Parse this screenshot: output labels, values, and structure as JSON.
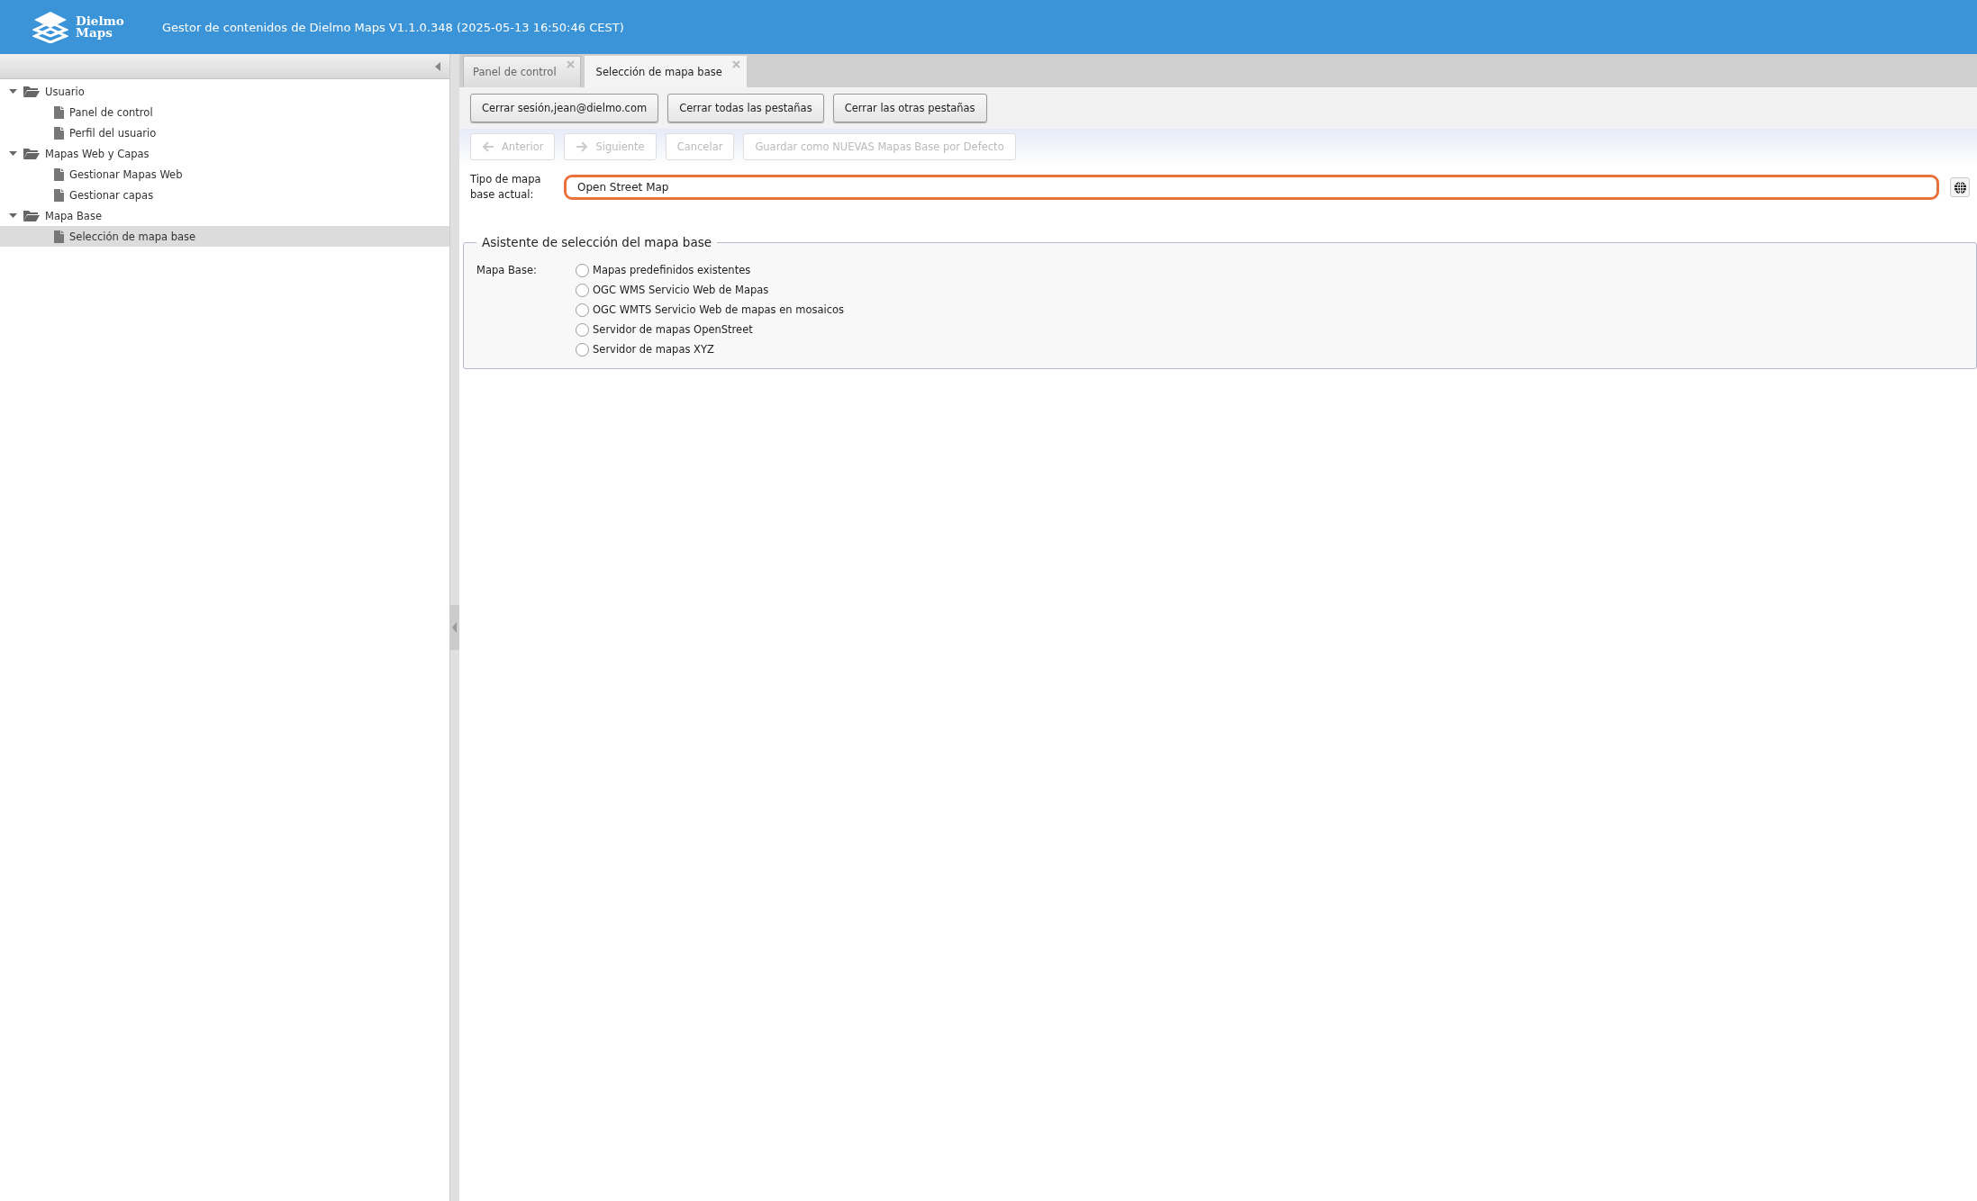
{
  "header": {
    "logo_lines": [
      "Dielmo",
      "Maps"
    ],
    "title": "Gestor de contenidos de Dielmo Maps V1.1.0.348 (2025-05-13 16:50:46 CEST)"
  },
  "sidebar": {
    "tree": [
      {
        "label": "Usuario",
        "kind": "folder",
        "expanded": true,
        "selected": false,
        "children": [
          {
            "label": "Panel de control",
            "kind": "page",
            "selected": false
          },
          {
            "label": "Perfil del usuario",
            "kind": "page",
            "selected": false
          }
        ]
      },
      {
        "label": "Mapas Web y Capas",
        "kind": "folder",
        "expanded": true,
        "selected": false,
        "children": [
          {
            "label": "Gestionar Mapas Web",
            "kind": "page",
            "selected": false
          },
          {
            "label": "Gestionar capas",
            "kind": "page",
            "selected": false
          }
        ]
      },
      {
        "label": "Mapa Base",
        "kind": "folder",
        "expanded": true,
        "selected": false,
        "children": [
          {
            "label": "Selección de mapa base",
            "kind": "page",
            "selected": true
          }
        ]
      }
    ]
  },
  "tabs": [
    {
      "label": "Panel de control",
      "selected": false
    },
    {
      "label": "Selección de mapa base",
      "selected": true
    }
  ],
  "toolbar": [
    "Cerrar sesión,jean@dielmo.com",
    "Cerrar todas las pestañas",
    "Cerrar las otras pestañas"
  ],
  "wizard_nav": [
    {
      "label": "Anterior",
      "kind": "back",
      "disabled": true
    },
    {
      "label": "Siguiente",
      "kind": "next",
      "disabled": true
    },
    {
      "label": "Cancelar",
      "kind": "plain",
      "disabled": true
    },
    {
      "label": "Guardar como NUEVAS Mapas Base por Defecto",
      "kind": "plain",
      "disabled": true
    }
  ],
  "current_map": {
    "label": "Tipo de mapa base actual:",
    "value": "Open Street Map",
    "focused": true
  },
  "wizard": {
    "legend": "Asistente de selección del mapa base",
    "field_label": "Mapa Base:",
    "options": [
      {
        "label": "Mapas predefinidos existentes",
        "selected": false
      },
      {
        "label": "OGC WMS Servicio Web de Mapas",
        "selected": false
      },
      {
        "label": "OGC WMTS Servicio Web de mapas en mosaicos",
        "selected": false
      },
      {
        "label": "Servidor de mapas OpenStreet",
        "selected": false
      },
      {
        "label": "Servidor de mapas XYZ",
        "selected": false
      }
    ]
  }
}
